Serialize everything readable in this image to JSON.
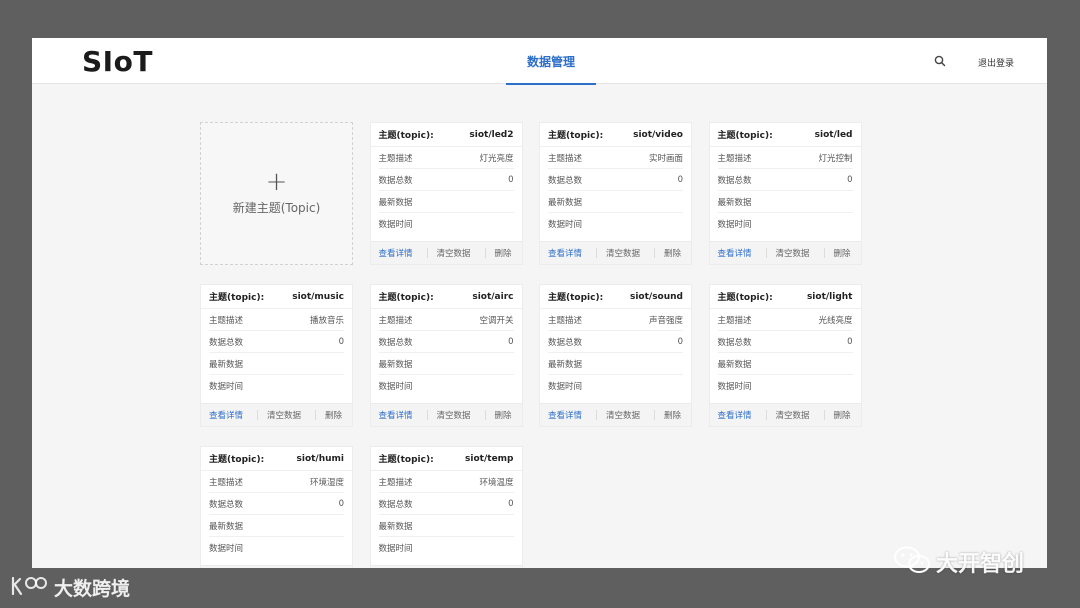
{
  "app": {
    "logo": "SIoT"
  },
  "nav": {
    "active_tab": "数据管理"
  },
  "header": {
    "logout_label": "退出登录",
    "search_icon": "search-icon"
  },
  "new_topic": {
    "label": "新建主题(Topic)",
    "icon": "+"
  },
  "card_labels": {
    "topic_prefix": "主题(topic):",
    "description": "主题描述",
    "total": "数据总数",
    "latest": "最新数据",
    "time": "数据时间",
    "view": "查看详情",
    "clear": "清空数据",
    "delete": "删除"
  },
  "topics": [
    {
      "topic": "siot/led2",
      "description": "灯光亮度",
      "total": "0"
    },
    {
      "topic": "siot/video",
      "description": "实时画面",
      "total": "0"
    },
    {
      "topic": "siot/led",
      "description": "灯光控制",
      "total": "0"
    },
    {
      "topic": "siot/music",
      "description": "播放音乐",
      "total": "0"
    },
    {
      "topic": "siot/airc",
      "description": "空调开关",
      "total": "0"
    },
    {
      "topic": "siot/sound",
      "description": "声音强度",
      "total": "0"
    },
    {
      "topic": "siot/light",
      "description": "光线亮度",
      "total": "0"
    },
    {
      "topic": "siot/humi",
      "description": "环境湿度",
      "total": "0"
    },
    {
      "topic": "siot/temp",
      "description": "环境温度",
      "total": "0"
    }
  ],
  "watermarks": {
    "left": "大数跨境",
    "right": "大开智创"
  }
}
